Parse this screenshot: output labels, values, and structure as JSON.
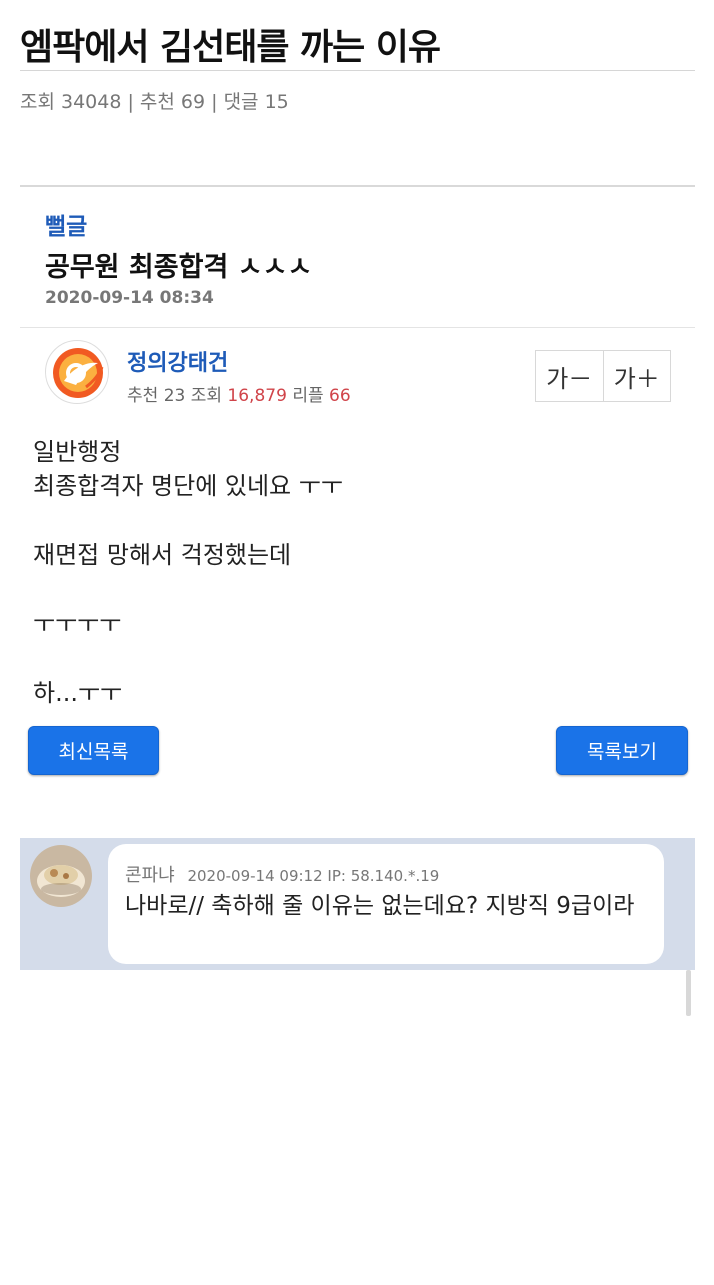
{
  "page": {
    "title": "엠팍에서 김선태를 까는 이유",
    "meta": "조회 34048 | 추천 69 | 댓글 15"
  },
  "post": {
    "board": "뻘글",
    "title": "공무원 최종합격 ㅅㅅㅅ",
    "date": "2020-09-14 08:34",
    "author": "정의강태건",
    "stats": {
      "rec_label": "추천",
      "rec": "23",
      "views_label": "조회",
      "views": "16,879",
      "reply_label": "리플",
      "replies": "66"
    },
    "font_buttons": {
      "smaller": "가－",
      "larger": "가＋"
    },
    "body": {
      "line1": "일반행정",
      "line2": "최종합격자 명단에 있네요 ㅜㅜ",
      "line3": "재면접 망해서 걱정했는데",
      "line4": "ㅜㅜㅜㅜ",
      "line5": "하...ㅜㅜ"
    },
    "buttons": {
      "recent": "최신목록",
      "list": "목록보기"
    }
  },
  "comment": {
    "nick": "콘파냐",
    "meta": "2020-09-14 09:12  IP: 58.140.*.19",
    "text": "나바로// 축하해 줄 이유는 없는데요? 지방직 9급이라"
  },
  "colors": {
    "accent": "#1a73e8",
    "link_blue": "#1e5bb8",
    "highlight_red": "#d0444a",
    "comment_bg": "#d4dcea"
  },
  "icons": {
    "author_avatar": "flame-logo-icon",
    "comment_avatar": "bowl-photo-icon"
  }
}
